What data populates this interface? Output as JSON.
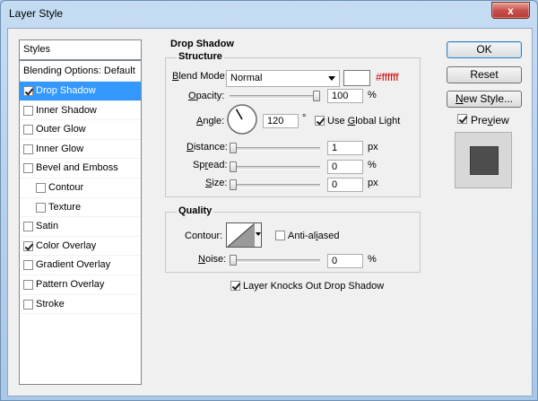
{
  "window": {
    "title": "Layer Style",
    "close_glyph": "x"
  },
  "styles_list": {
    "header": "Styles",
    "items": [
      {
        "label": "Blending Options: Default",
        "has_checkbox": false,
        "checked": false,
        "selected": false,
        "indent": false
      },
      {
        "label": "Drop Shadow",
        "has_checkbox": true,
        "checked": true,
        "selected": true,
        "indent": false
      },
      {
        "label": "Inner Shadow",
        "has_checkbox": true,
        "checked": false,
        "selected": false,
        "indent": false
      },
      {
        "label": "Outer Glow",
        "has_checkbox": true,
        "checked": false,
        "selected": false,
        "indent": false
      },
      {
        "label": "Inner Glow",
        "has_checkbox": true,
        "checked": false,
        "selected": false,
        "indent": false
      },
      {
        "label": "Bevel and Emboss",
        "has_checkbox": true,
        "checked": false,
        "selected": false,
        "indent": false
      },
      {
        "label": "Contour",
        "has_checkbox": true,
        "checked": false,
        "selected": false,
        "indent": true
      },
      {
        "label": "Texture",
        "has_checkbox": true,
        "checked": false,
        "selected": false,
        "indent": true
      },
      {
        "label": "Satin",
        "has_checkbox": true,
        "checked": false,
        "selected": false,
        "indent": false
      },
      {
        "label": "Color Overlay",
        "has_checkbox": true,
        "checked": true,
        "selected": false,
        "indent": false
      },
      {
        "label": "Gradient Overlay",
        "has_checkbox": true,
        "checked": false,
        "selected": false,
        "indent": false
      },
      {
        "label": "Pattern Overlay",
        "has_checkbox": true,
        "checked": false,
        "selected": false,
        "indent": false
      },
      {
        "label": "Stroke",
        "has_checkbox": true,
        "checked": false,
        "selected": false,
        "indent": false
      }
    ]
  },
  "drop_shadow": {
    "section_title": "Drop Shadow",
    "structure": {
      "title": "Structure",
      "blend_mode_label": "Blend Mode:",
      "blend_mode_value": "Normal",
      "color_hex_text": "#ffffff",
      "color_swatch": "#ffffff",
      "color_text_color": "#cc0000",
      "opacity_label": "Opacity:",
      "opacity_value": "100",
      "opacity_fraction": 1.0,
      "opacity_unit": "%",
      "angle_label": "Angle:",
      "angle_value": "120",
      "angle_unit": "°",
      "use_global_light_label": "Use Global Light",
      "use_global_light_checked": true,
      "distance_label": "Distance:",
      "distance_value": "1",
      "distance_fraction": 0.0,
      "distance_unit": "px",
      "spread_label": "Spread:",
      "spread_value": "0",
      "spread_fraction": 0.0,
      "spread_unit": "%",
      "size_label": "Size:",
      "size_value": "0",
      "size_fraction": 0.0,
      "size_unit": "px"
    },
    "quality": {
      "title": "Quality",
      "contour_label": "Contour:",
      "anti_aliased_label": "Anti-aliased",
      "anti_aliased_checked": false,
      "noise_label": "Noise:",
      "noise_value": "0",
      "noise_fraction": 0.0,
      "noise_unit": "%"
    },
    "knockout_label": "Layer Knocks Out Drop Shadow",
    "knockout_checked": true
  },
  "buttons": {
    "ok": "OK",
    "reset": "Reset",
    "new_style": "New Style...",
    "preview_label": "Preview",
    "preview_checked": true
  },
  "colors": {
    "selection": "#3399ff",
    "preview_swatch": "#4d4d4d"
  }
}
